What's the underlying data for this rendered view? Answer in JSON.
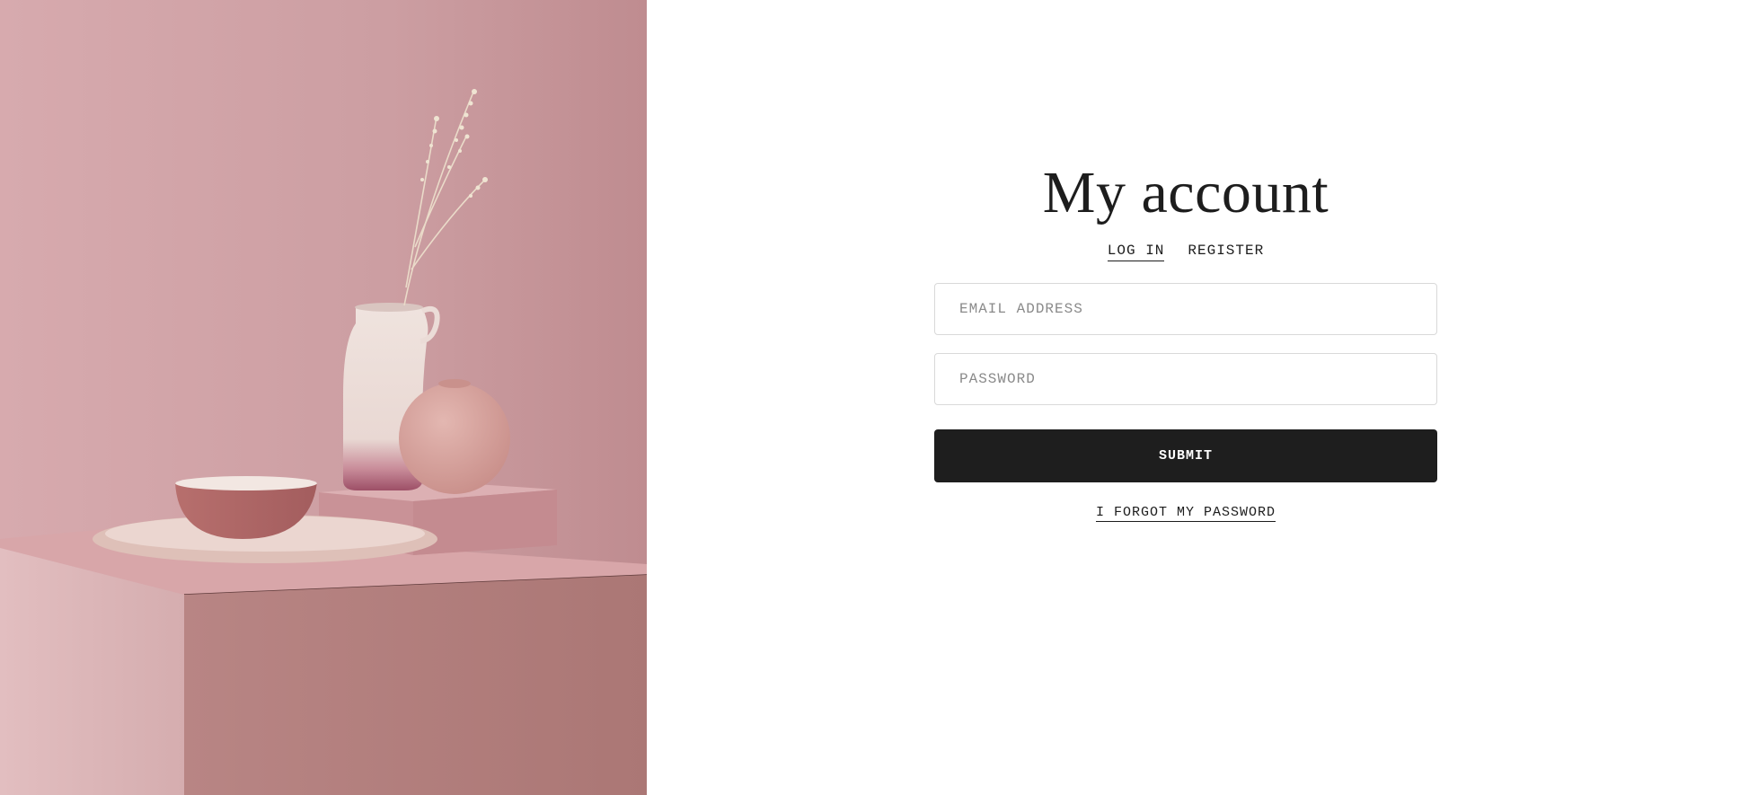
{
  "hero": {
    "image": "pink-ceramics-still-life",
    "colors": {
      "wall": "#cfa0a4",
      "pedestal_top": "#d7a3a6",
      "pedestal_front": "#b7817f",
      "pedestal_side": "#ddb6b8",
      "vase": "#ebdcd7",
      "round_vase": "#d7a49f",
      "bowl": "#b26a6a",
      "plate": "#e2c3bc"
    }
  },
  "account": {
    "title": "My account",
    "tabs": [
      {
        "label": "LOG IN",
        "active": true
      },
      {
        "label": "REGISTER",
        "active": false
      }
    ],
    "email_placeholder": "EMAIL ADDRESS",
    "password_placeholder": "PASSWORD",
    "submit_label": "SUBMIT",
    "forgot_label": "I FORGOT MY PASSWORD"
  },
  "colors": {
    "text": "#1d1d1d",
    "button_bg": "#1e1e1e",
    "field_border": "#d9d9d9"
  }
}
